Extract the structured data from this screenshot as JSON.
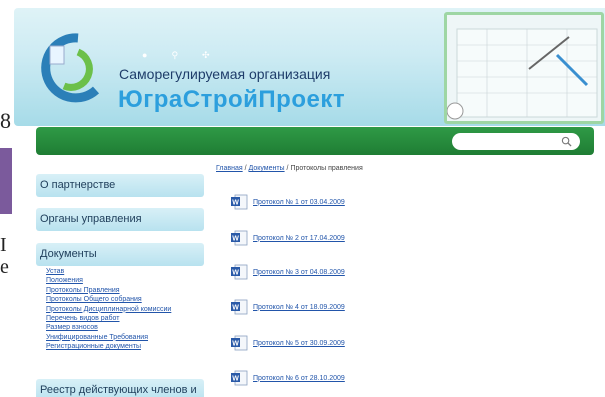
{
  "edge": {
    "frag1": "8",
    "frag2": "I",
    "frag3": "e"
  },
  "header": {
    "org_line1": "Саморегулируемая организация",
    "org_line2": "ЮграСтройПроект",
    "icons": [
      "home-icon",
      "search-icon",
      "sitemap-icon"
    ]
  },
  "search": {
    "placeholder": ""
  },
  "sidebar": {
    "sections": [
      {
        "label": "О партнерстве"
      },
      {
        "label": "Органы управления"
      },
      {
        "label": "Документы"
      },
      {
        "label": "Реестр действующих членов и"
      }
    ],
    "subnav": [
      "Устав",
      "Положения",
      "Протоколы Правления",
      "Протоколы Общего собрания",
      "Протоколы Дисциплинарной комиссии",
      "Перечень видов работ",
      "Размер взносов",
      "Унифицированные Требования",
      "Регистрационные документы"
    ]
  },
  "breadcrumb": {
    "home": "Главная",
    "sep1": " / ",
    "docs": "Документы",
    "sep2": " / ",
    "current": "Протоколы правления"
  },
  "documents": [
    "Протокол № 1 от 03.04.2009",
    "Протокол № 2 от 17.04.2009",
    "Протокол № 3 от 04.08.2009",
    "Протокол № 4 от 18.09.2009",
    "Протокол № 5 от 30.09.2009",
    "Протокол № 6 от 28.10.2009"
  ],
  "colors": {
    "green": "#1f7d34",
    "link": "#2255aa",
    "brand_blue": "#2c9fdd",
    "title": "#1e3d6a"
  }
}
